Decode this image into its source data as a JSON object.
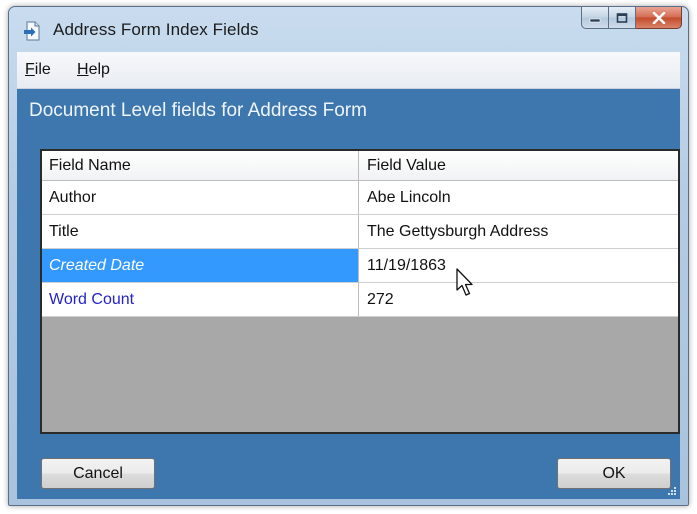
{
  "window": {
    "title": "Address Form Index Fields",
    "app_icon": "document-arrow-icon",
    "caption_buttons": [
      "minimize-icon",
      "maximize-icon",
      "close-icon"
    ]
  },
  "menu": {
    "items": [
      {
        "label": "File",
        "accel": "F",
        "rest": "ile"
      },
      {
        "label": "Help",
        "accel": "H",
        "rest": "elp"
      }
    ]
  },
  "section_title": "Document Level fields for Address Form",
  "grid": {
    "columns": [
      "Field Name",
      "Field Value"
    ],
    "rows": [
      {
        "name": "Author",
        "value": "Abe Lincoln"
      },
      {
        "name": "Title",
        "value": "The Gettysburgh Address"
      },
      {
        "name": "Created Date",
        "value": "11/19/1863"
      },
      {
        "name": "Word Count",
        "value": "272"
      }
    ]
  },
  "buttons": {
    "cancel": "Cancel",
    "ok": "OK"
  },
  "colors": {
    "client_background": "#3e77ad",
    "selection": "#3399ff",
    "required_field_text": "#2323c8",
    "grid_empty_area": "#a8a8a8"
  }
}
